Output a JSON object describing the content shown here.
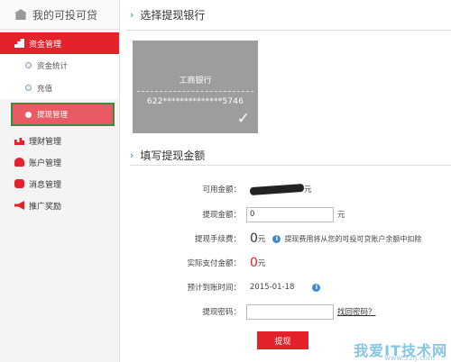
{
  "sidebar": {
    "brand": "我的可投可贷",
    "sections": {
      "fund": "资金管理",
      "finance": "理财管理",
      "account": "账户管理",
      "message": "消息管理",
      "promo": "推广奖励"
    },
    "subs": {
      "stats": "资金统计",
      "recharge": "充值",
      "withdraw": "提现管理"
    }
  },
  "main": {
    "bank_title": "选择提现银行",
    "card": {
      "bank": "工商银行",
      "number": "622**************5746",
      "check": "✓"
    },
    "amount_title": "填写提现金额",
    "form": {
      "available_label": "可用金额：",
      "available_unit": "元",
      "amount_label": "提现金额：",
      "amount_value": "0",
      "amount_unit": "元",
      "fee_label": "提现手续费：",
      "fee_value": "0",
      "fee_unit": "元",
      "fee_hint": "提现费用将从您的可投可贷账户余额中扣除",
      "actual_label": "实际支付金额：",
      "actual_value": "0",
      "actual_unit": "元",
      "arrival_label": "预计到账时间：",
      "arrival_value": "2015-01-18",
      "password_label": "提现密码：",
      "forgot_link": "找回密码？",
      "submit": "提现"
    }
  },
  "watermark": {
    "text": "我爱IT技术网",
    "url": "www.52ij.com"
  },
  "colors": {
    "accent": "#e4222c",
    "info": "#3b8ad4",
    "card": "#9d9d9d"
  }
}
